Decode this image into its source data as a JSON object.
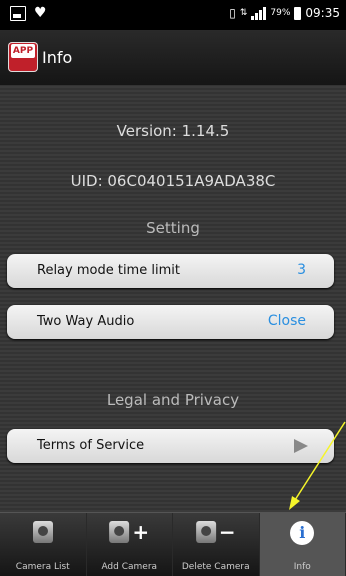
{
  "status_bar": {
    "battery": "79%",
    "time": "09:35"
  },
  "header": {
    "app_icon_text": "APP",
    "title": "Info"
  },
  "info": {
    "version": "Version: 1.14.5",
    "uid": "UID: 06C040151A9ADA38C",
    "setting_heading": "Setting",
    "legal_heading": "Legal and Privacy"
  },
  "settings": {
    "relay": {
      "label": "Relay mode time limit",
      "value": "3"
    },
    "audio": {
      "label": "Two Way Audio",
      "value": "Close"
    },
    "terms": {
      "label": "Terms of Service"
    }
  },
  "tabs": [
    {
      "label": "Camera List"
    },
    {
      "label": "Add Camera"
    },
    {
      "label": "Delete Camera"
    },
    {
      "label": "Info"
    }
  ],
  "colors": {
    "accent": "#2a8fe0",
    "annotation_arrow": "#f5f52a"
  }
}
